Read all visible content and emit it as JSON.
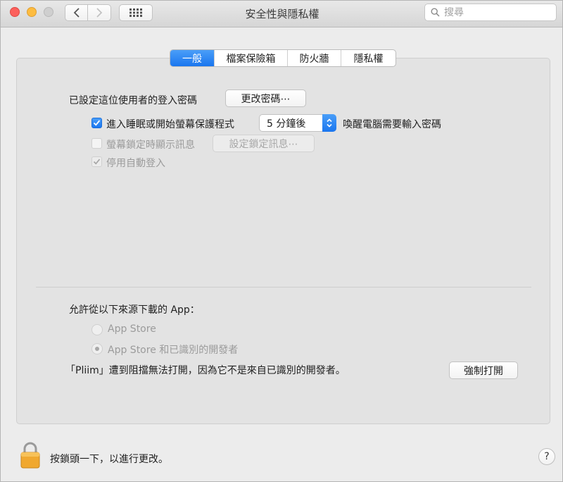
{
  "window": {
    "title": "安全性與隱私權"
  },
  "search": {
    "placeholder": "搜尋"
  },
  "tabs": [
    {
      "label": "一般",
      "active": true
    },
    {
      "label": "檔案保險箱",
      "active": false
    },
    {
      "label": "防火牆",
      "active": false
    },
    {
      "label": "隱私權",
      "active": false
    }
  ],
  "general": {
    "password_label": "已設定這位使用者的登入密碼",
    "change_password_button": "更改密碼⋯",
    "require_password": {
      "label": "進入睡眠或開始螢幕保護程式",
      "checked": true,
      "delay_value": "5 分鐘後",
      "suffix": "喚醒電腦需要輸入密碼"
    },
    "lock_message": {
      "label": "螢幕鎖定時顯示訊息",
      "checked": false,
      "button": "設定鎖定訊息⋯"
    },
    "disable_auto_login": {
      "label": "停用自動登入",
      "checked": true
    }
  },
  "downloads": {
    "heading": "允許從以下來源下載的 App：",
    "options": [
      {
        "label": "App Store",
        "selected": false
      },
      {
        "label": "App Store 和已識別的開發者",
        "selected": true
      }
    ],
    "blocked_message": "「Pliim」遭到阻擋無法打開，因為它不是來自已識別的開發者。",
    "open_anyway_button": "強制打開"
  },
  "footer": {
    "lock_text": "按鎖頭一下，以進行更改。",
    "help_label": "?"
  },
  "colors": {
    "accent": "#1a76ef",
    "lock": "#f0a830"
  }
}
